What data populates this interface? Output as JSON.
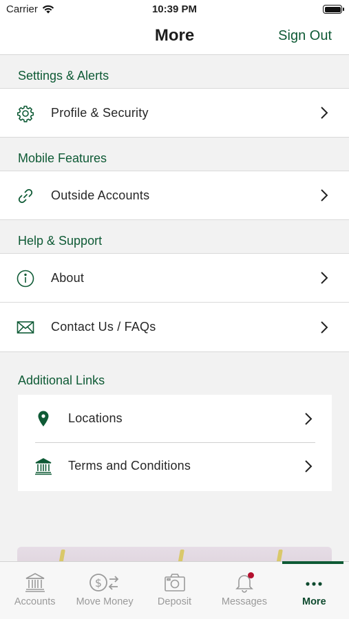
{
  "status_bar": {
    "carrier": "Carrier",
    "time": "10:39 PM"
  },
  "nav": {
    "title": "More",
    "sign_out": "Sign Out"
  },
  "sections": [
    {
      "header": "Settings & Alerts",
      "items": [
        {
          "label": "Profile & Security",
          "icon": "gear-icon"
        }
      ]
    },
    {
      "header": "Mobile Features",
      "items": [
        {
          "label": "Outside Accounts",
          "icon": "link-icon"
        }
      ]
    },
    {
      "header": "Help & Support",
      "items": [
        {
          "label": "About",
          "icon": "info-icon"
        },
        {
          "label": "Contact Us / FAQs",
          "icon": "envelope-icon"
        }
      ]
    }
  ],
  "additional_links": {
    "header": "Additional Links",
    "items": [
      {
        "label": "Locations",
        "icon": "location-pin-icon"
      },
      {
        "label": "Terms and Conditions",
        "icon": "bank-icon"
      }
    ]
  },
  "tabs": [
    {
      "label": "Accounts",
      "icon": "bank-icon",
      "active": false
    },
    {
      "label": "Move Money",
      "icon": "money-transfer-icon",
      "active": false
    },
    {
      "label": "Deposit",
      "icon": "camera-icon",
      "active": false
    },
    {
      "label": "Messages",
      "icon": "bell-icon",
      "active": false,
      "badge": true
    },
    {
      "label": "More",
      "icon": "more-dots-icon",
      "active": true
    }
  ],
  "colors": {
    "brand_green": "#0e5a35",
    "badge_red": "#b3102e",
    "tab_inactive": "#9a9a9a"
  }
}
